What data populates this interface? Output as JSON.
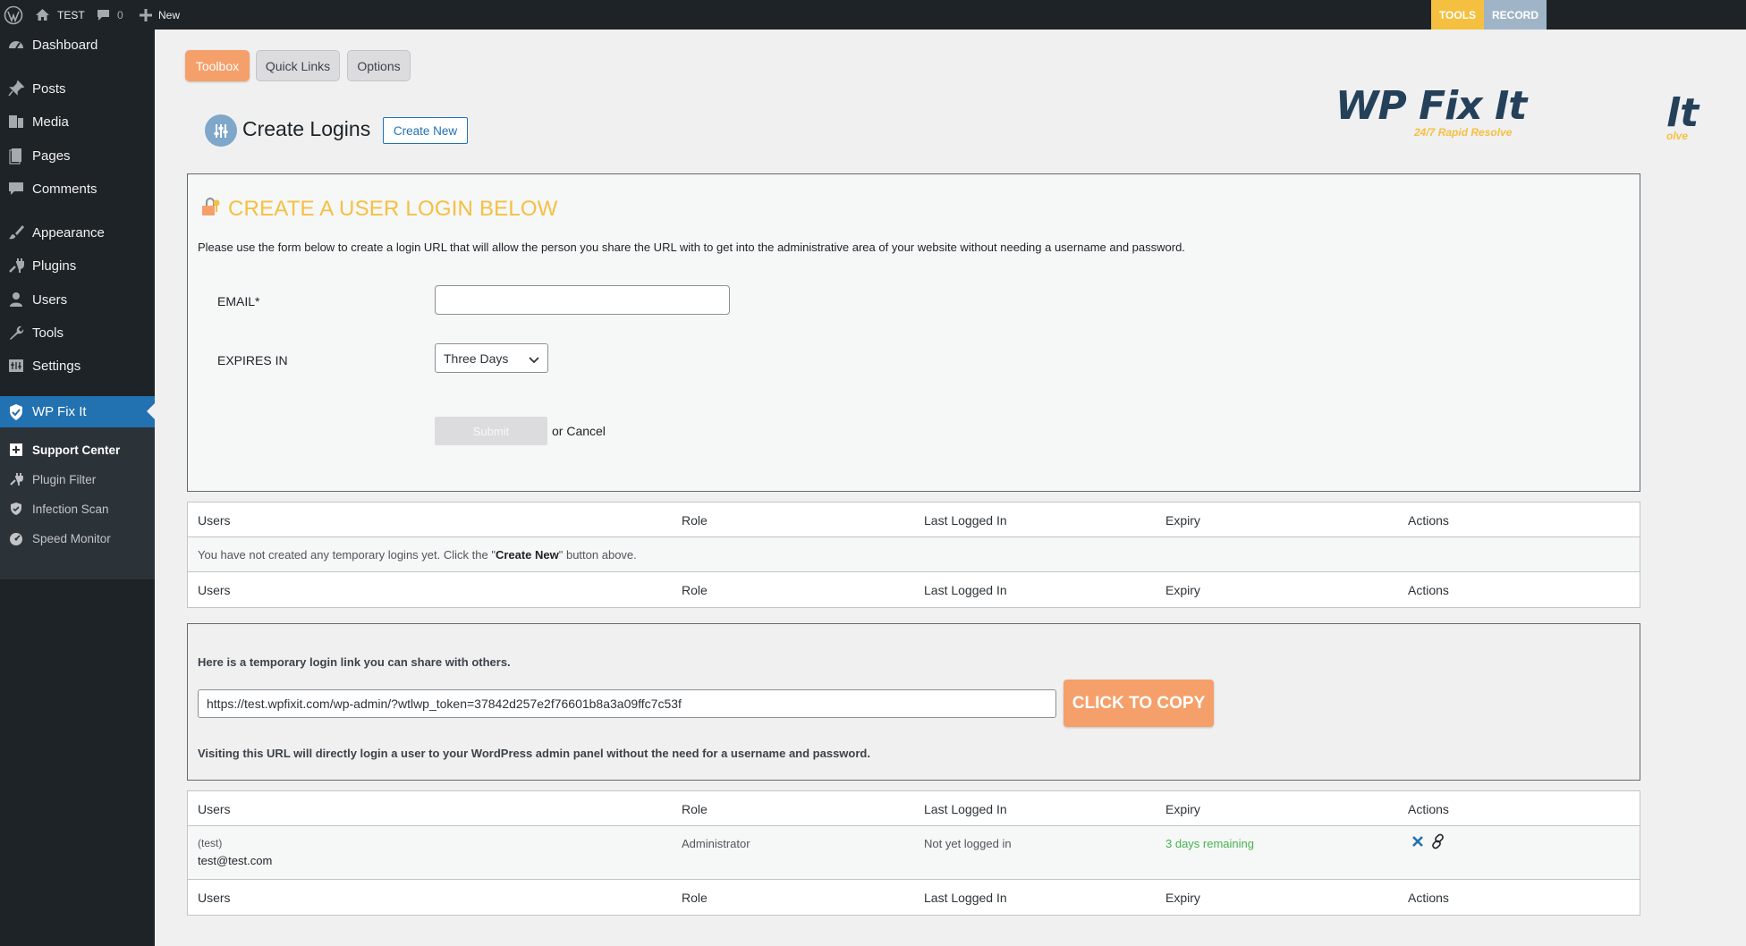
{
  "adminbar": {
    "site_name": "TEST",
    "comments_count": "0",
    "new_label": "New",
    "tools_label": "TOOLS",
    "record_label": "RECORD"
  },
  "sidebar": {
    "items": [
      {
        "label": "Dashboard",
        "icon": "dashboard-icon"
      },
      {
        "label": "Posts",
        "icon": "pushpin-icon"
      },
      {
        "label": "Media",
        "icon": "media-icon"
      },
      {
        "label": "Pages",
        "icon": "page-icon"
      },
      {
        "label": "Comments",
        "icon": "comment-icon"
      },
      {
        "label": "Appearance",
        "icon": "brush-icon"
      },
      {
        "label": "Plugins",
        "icon": "plug-icon"
      },
      {
        "label": "Users",
        "icon": "user-icon"
      },
      {
        "label": "Tools",
        "icon": "wrench-icon"
      },
      {
        "label": "Settings",
        "icon": "settings-icon"
      },
      {
        "label": "WP Fix It",
        "icon": "shield-icon"
      }
    ],
    "submenu": [
      {
        "label": "Support Center",
        "icon": "support-icon"
      },
      {
        "label": "Plugin Filter",
        "icon": "plug-icon"
      },
      {
        "label": "Infection Scan",
        "icon": "shield-icon"
      },
      {
        "label": "Speed Monitor",
        "icon": "gauge-icon"
      }
    ]
  },
  "tabs": {
    "toolbox": "Toolbox",
    "quick_links": "Quick Links",
    "options": "Options"
  },
  "page": {
    "title": "Create Logins",
    "create_new": "Create New"
  },
  "brand": {
    "name": "WP Fix It",
    "tagline": "24/7 Rapid Resolve",
    "ghost_name": "lt",
    "ghost_tagline": "olve"
  },
  "form": {
    "heading": "CREATE A USER LOGIN BELOW",
    "description": "Please use the form below to create a login URL that will allow the person you share the URL with to get into the administrative area of your website without needing a username and password.",
    "email_label": "EMAIL*",
    "email_value": "",
    "expires_label": "EXPIRES IN",
    "expires_value": "Three Days",
    "submit_label": "Submit",
    "or_cancel": "or Cancel"
  },
  "table_headers": {
    "users": "Users",
    "role": "Role",
    "last_logged_in": "Last Logged In",
    "expiry": "Expiry",
    "actions": "Actions"
  },
  "empty_table": {
    "message_prefix": "You have not created any temporary logins yet. Click the \"",
    "message_bold": "Create New",
    "message_suffix": "\" button above."
  },
  "link_panel": {
    "intro": "Here is a temporary login link you can share with others.",
    "url": "https://test.wpfixit.com/wp-admin/?wtlwp_token=37842d257e2f76601b8a3a09ffc7c53f",
    "copy_label": "CLICK TO COPY",
    "note": "Visiting this URL will directly login a user to your WordPress admin panel without the need for a username and password."
  },
  "user_row": {
    "name": "(test)",
    "email": "test@test.com",
    "role": "Administrator",
    "last_logged_in": "Not yet logged in",
    "expiry": "3 days remaining",
    "expiry_color": "#46b450"
  },
  "colors": {
    "accent_orange": "#f5a06a",
    "heading_yellow": "#f5c040",
    "wp_blue": "#2271b1"
  }
}
